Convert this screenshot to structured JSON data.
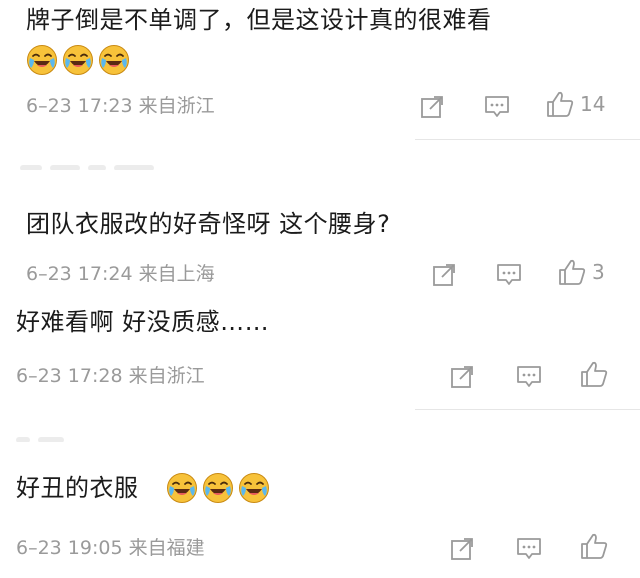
{
  "comments": [
    {
      "text": "牌子倒是不单调了，但是这设计真的很难看",
      "emoji": "crying-laughing",
      "meta": "6–23 17:23 来自浙江",
      "likes": "14"
    },
    {
      "text": "团队衣服改的好奇怪呀 这个腰身?",
      "meta": "6–23 17:24 来自上海",
      "likes": "3"
    },
    {
      "text": "好难看啊 好没质感……",
      "meta": "6–23 17:28 来自浙江",
      "likes": ""
    },
    {
      "text": "好丑的衣服",
      "emoji": "crying-laughing",
      "meta": "6–23 19:05 来自福建",
      "likes": ""
    }
  ],
  "icons": {
    "share": "share-icon",
    "comment": "comment-icon",
    "like": "thumbs-up-icon"
  },
  "colors": {
    "text": "#1b1b1b",
    "meta": "#9a9a9a",
    "icon": "#9a9a9a",
    "emoji_face": "#f7c23a"
  }
}
